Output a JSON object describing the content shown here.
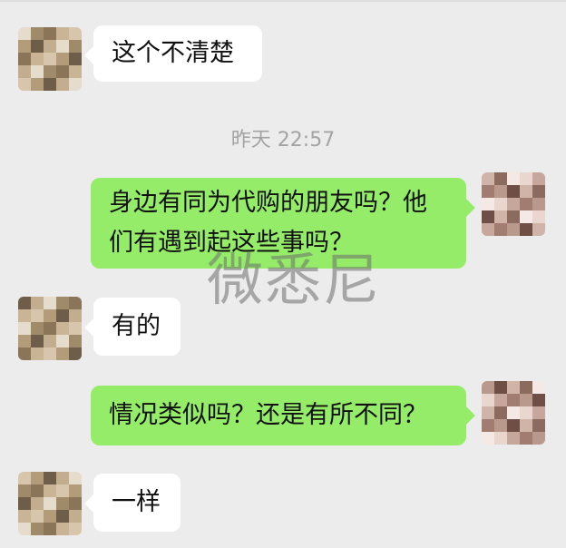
{
  "timestamp": "昨天 22:57",
  "watermark": "微悉尼",
  "messages": [
    {
      "side": "in",
      "text": "这个不清楚"
    },
    {
      "side": "out",
      "text": "身边有同为代购的朋友吗？他\n们有遇到起这些事吗？"
    },
    {
      "side": "in",
      "text": "有的"
    },
    {
      "side": "out",
      "text": "情况类似吗？还是有所不同？"
    },
    {
      "side": "in",
      "text": "一样"
    }
  ],
  "colors": {
    "chat_background": "#ececec",
    "incoming_bubble": "#ffffff",
    "outgoing_bubble": "#95ec69"
  }
}
